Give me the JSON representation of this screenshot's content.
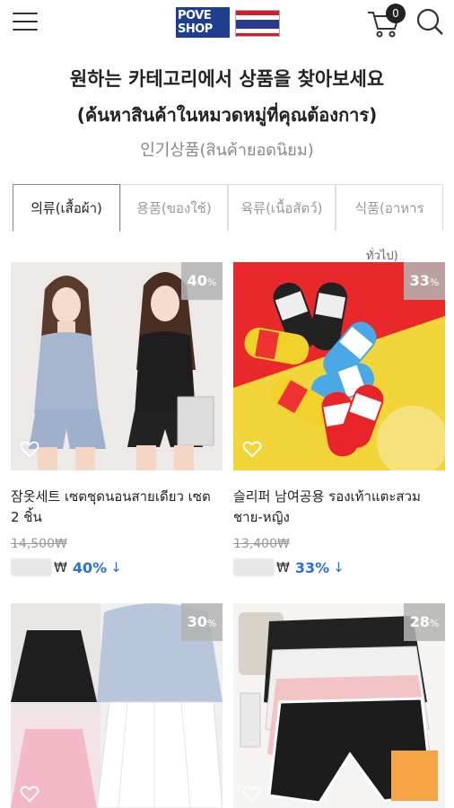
{
  "header": {
    "logo_line1": "POVE",
    "logo_line2": "SHOP",
    "cart_count": "0"
  },
  "title_ko": "원하는 카테고리에서 상품을 찾아보세요",
  "title_th": "(ค้นหาสินค้าในหมวดหมู่ที่คุณต้องการ)",
  "subtitle": "인기상품(สินค้ายอดนิยม)",
  "tabs": [
    {
      "label": "의류(เสื้อผ้า)"
    },
    {
      "label": "용품(ของใช้)"
    },
    {
      "label": "육류(เนื้อสัตว์)"
    },
    {
      "label": "식품(อาหาร"
    }
  ],
  "tab_sub": "ทั่วไป)",
  "products": [
    {
      "discount": "40",
      "pct_sign": "%",
      "name": "잠옷세트 เซตชุดนอนสายเดียว เซต 2 ชิ้น",
      "orig_price": "14,500₩",
      "currency": "₩",
      "pct_label": "40%",
      "arrow": "↓"
    },
    {
      "discount": "33",
      "pct_sign": "%",
      "name": "슬리퍼 남여공용 รองเท้าแตะสวม ชาย-หญิง",
      "orig_price": "13,400₩",
      "currency": "₩",
      "pct_label": "33%",
      "arrow": "↓"
    },
    {
      "discount": "30",
      "pct_sign": "%",
      "name": "",
      "orig_price": "",
      "currency": "",
      "pct_label": "",
      "arrow": ""
    },
    {
      "discount": "28",
      "pct_sign": "%",
      "name": "",
      "orig_price": "",
      "currency": "",
      "pct_label": "",
      "arrow": ""
    }
  ],
  "colors": {
    "accent": "#2a72c8",
    "logo_bg": "#1f3f8e"
  }
}
